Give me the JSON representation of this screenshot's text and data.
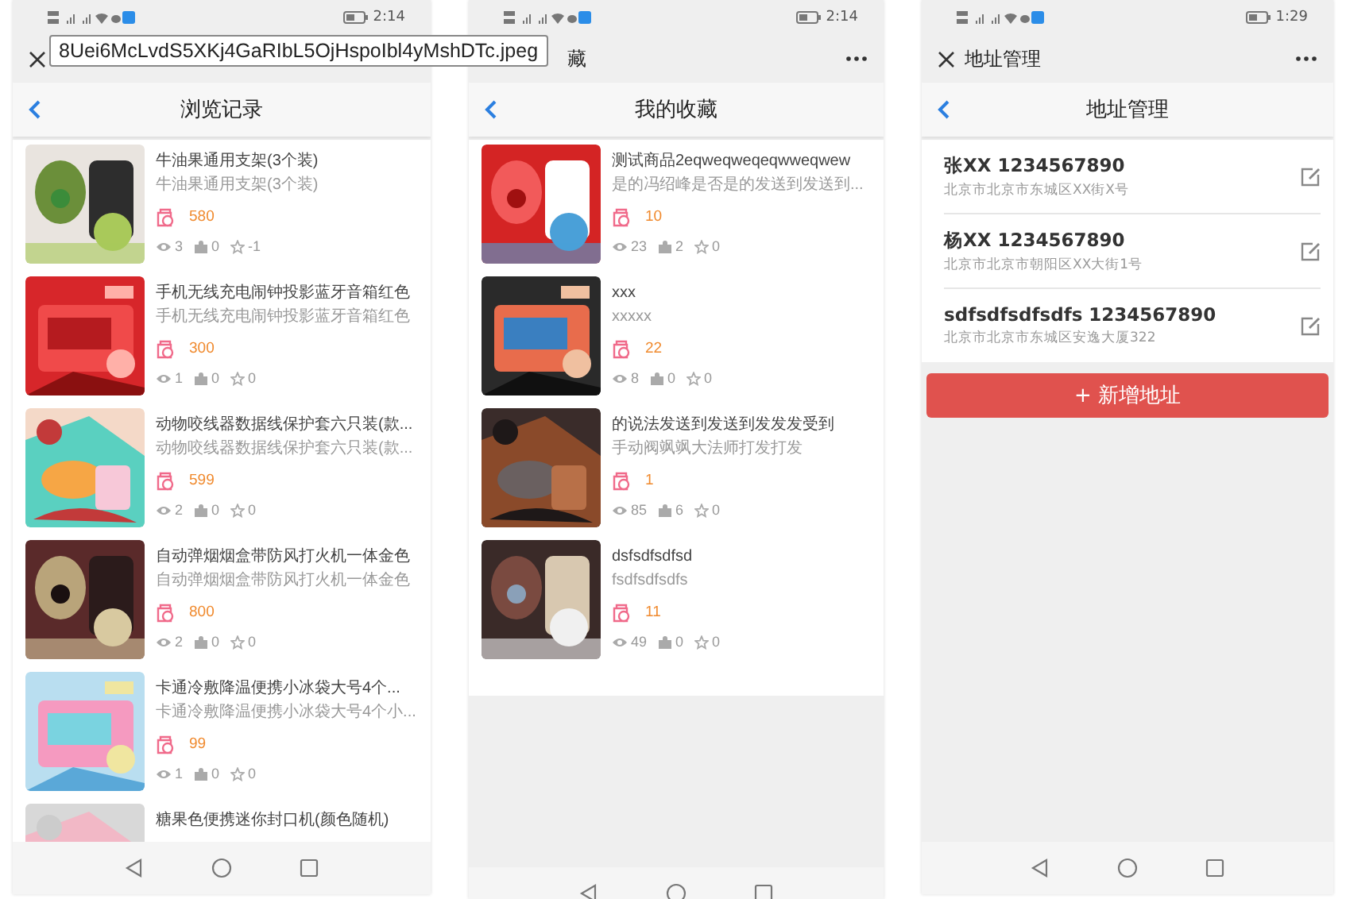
{
  "tooltip": {
    "text": "8Uei6McLvdS5XKj4GaRIbL5OjHspoIbl4yMshDTc.jpeg"
  },
  "screens": [
    {
      "kind": "products",
      "status": {
        "time": "2:14"
      },
      "top_bar": {
        "close_icon": true,
        "more_icon": false
      },
      "header": {
        "title": "浏览记录"
      },
      "items": [
        {
          "title": "牛油果通用支架(3个装)",
          "subtitle": "牛油果通用支架(3个装)",
          "price": "580",
          "views": "3",
          "bags": "0",
          "favorites": "-1"
        },
        {
          "title": "手机无线充电闹钟投影蓝牙音箱红色",
          "subtitle": "手机无线充电闹钟投影蓝牙音箱红色",
          "price": "300",
          "views": "1",
          "bags": "0",
          "favorites": "0"
        },
        {
          "title": "动物咬线器数据线保护套六只装(款...",
          "subtitle": "动物咬线器数据线保护套六只装(款...",
          "price": "599",
          "views": "2",
          "bags": "0",
          "favorites": "0"
        },
        {
          "title": "自动弹烟烟盒带防风打火机一体金色",
          "subtitle": "自动弹烟烟盒带防风打火机一体金色",
          "price": "800",
          "views": "2",
          "bags": "0",
          "favorites": "0"
        },
        {
          "title": "卡通冷敷降温便携小冰袋大号4个...",
          "subtitle": "卡通冷敷降温便携小冰袋大号4个小...",
          "price": "99",
          "views": "1",
          "bags": "0",
          "favorites": "0"
        },
        {
          "title": "糖果色便携迷你封口机(颜色随机)"
        }
      ]
    },
    {
      "kind": "products",
      "status": {
        "time": "2:14"
      },
      "top_bar": {
        "close_icon": false,
        "title": "藏",
        "more_icon": true
      },
      "header": {
        "title": "我的收藏"
      },
      "items": [
        {
          "title": "测试商品2eqweqweqeqwweqwew",
          "subtitle": "是的冯绍峰是否是的发送到发送到...",
          "price": "10",
          "views": "23",
          "bags": "2",
          "favorites": "0"
        },
        {
          "title": "xxx",
          "subtitle": "xxxxx",
          "price": "22",
          "views": "8",
          "bags": "0",
          "favorites": "0"
        },
        {
          "title": "的说法发送到发送到发发发受到",
          "subtitle": "手动阀飒飒大法师打发打发",
          "price": "1",
          "views": "85",
          "bags": "6",
          "favorites": "0"
        },
        {
          "title": "dsfsdfsdfsd",
          "subtitle": "fsdfsdfsdfs",
          "price": "11",
          "views": "49",
          "bags": "0",
          "favorites": "0"
        }
      ]
    },
    {
      "kind": "addresses",
      "status": {
        "time": "1:29"
      },
      "top_bar": {
        "close_icon": true,
        "title": "地址管理",
        "more_icon": true
      },
      "header": {
        "title": "地址管理"
      },
      "addresses": [
        {
          "name": "张XX 1234567890",
          "address": "北京市北京市东城区XX街X号"
        },
        {
          "name": "杨XX 1234567890",
          "address": "北京市北京市朝阳区XX大街1号"
        },
        {
          "name": "sdfsdfsdfsdfs 1234567890",
          "address": "北京市北京市东城区安逸大厦322"
        }
      ],
      "add_button": "+ 新增地址"
    }
  ]
}
